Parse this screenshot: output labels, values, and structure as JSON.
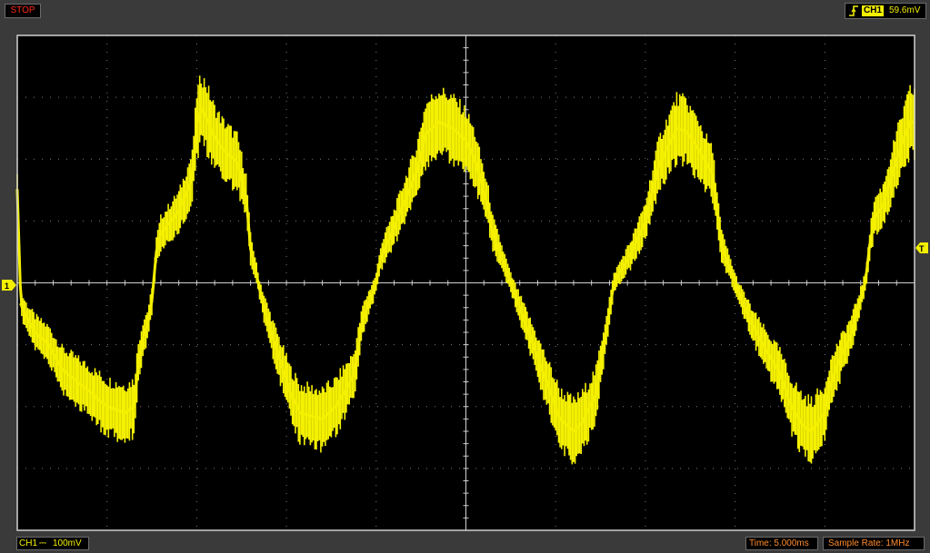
{
  "status": {
    "run_state": "STOP",
    "color": "#ff2a1a"
  },
  "trigger": {
    "edge_icon": "rising-edge-icon",
    "channel": "CH1",
    "level": "59.6mV"
  },
  "screen": {
    "ch1_marker": "1",
    "trigger_marker": "T",
    "trace_color": "#f4f000",
    "background": "#000000",
    "grid_color": "#7a7a7a",
    "divisions_x": 10,
    "divisions_y": 8
  },
  "footer": {
    "channel_label": "CH1",
    "coupling_icon": "dc-coupling-icon",
    "coupling_glyph": "⎓",
    "volts_per_div": "100mV",
    "time_base": "Time: 5.000ms",
    "sample_rate": "Sample Rate: 1MHz"
  },
  "chart_data": {
    "type": "line",
    "title": "",
    "xlabel": "",
    "ylabel": "",
    "xlim": [
      0,
      10
    ],
    "ylim": [
      -4,
      4
    ],
    "x_unit": "div (5.000ms/div)",
    "y_unit": "div (100mV/div)",
    "grid": true,
    "series": [
      {
        "x": [
          0.0,
          0.02,
          0.04,
          0.1,
          0.2,
          0.35,
          0.5,
          0.8,
          1.0,
          1.2,
          1.3,
          1.35,
          1.4,
          1.45,
          1.5,
          1.55,
          1.6,
          1.8,
          1.95,
          2.0,
          2.05,
          2.1,
          2.2,
          2.3,
          2.45,
          2.55,
          2.6,
          2.65,
          2.7,
          2.75,
          2.85,
          3.05,
          3.15,
          3.4,
          3.55,
          3.75,
          3.85,
          3.95,
          4.0,
          4.05,
          4.2,
          4.45,
          4.55,
          4.7,
          4.85,
          5.0,
          5.1,
          5.25,
          5.3,
          5.45,
          5.6,
          5.7,
          5.85,
          6.05,
          6.2,
          6.3,
          6.45,
          6.55,
          6.65,
          6.85,
          7.0,
          7.15,
          7.35,
          7.45,
          7.6,
          7.65,
          7.75,
          7.85,
          8.05,
          8.2,
          8.35,
          8.5,
          8.6,
          8.75,
          8.85,
          9.0,
          9.05,
          9.15,
          9.3,
          9.45,
          9.5,
          9.55,
          9.65,
          9.8,
          9.95
        ],
        "y": [
          1.5,
          0.6,
          -0.35,
          -0.55,
          -0.8,
          -1.0,
          -1.4,
          -1.75,
          -2.0,
          -2.1,
          -2.0,
          -1.3,
          -0.9,
          -0.7,
          -0.3,
          0.5,
          0.8,
          1.15,
          1.7,
          2.55,
          2.8,
          2.7,
          2.35,
          2.15,
          1.95,
          1.4,
          0.55,
          0.25,
          -0.1,
          -0.4,
          -0.9,
          -1.8,
          -2.1,
          -2.2,
          -2.0,
          -1.5,
          -0.6,
          -0.2,
          0.0,
          0.4,
          0.9,
          1.8,
          2.4,
          2.6,
          2.5,
          2.3,
          2.0,
          1.2,
          0.8,
          0.2,
          -0.4,
          -0.8,
          -1.4,
          -2.2,
          -2.4,
          -2.25,
          -1.8,
          -0.9,
          0.0,
          0.5,
          1.0,
          1.9,
          2.5,
          2.45,
          2.15,
          2.0,
          1.75,
          0.6,
          -0.2,
          -0.7,
          -1.1,
          -1.45,
          -1.9,
          -2.3,
          -2.4,
          -2.1,
          -1.7,
          -1.3,
          -0.8,
          0.0,
          0.6,
          1.05,
          1.25,
          2.0,
          2.6
        ]
      }
    ]
  }
}
